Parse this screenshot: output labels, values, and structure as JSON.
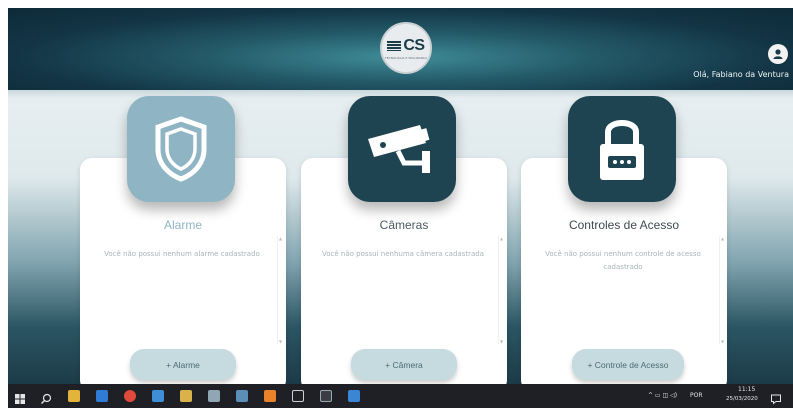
{
  "header": {
    "logo_text": "CS",
    "logo_subtext": "TECNOLOGIA E SEGURANÇA",
    "user_greeting": "Olá, Fabiano da Ventura",
    "colors": {
      "bar_dark": "#0e2a38",
      "bar_light": "#3f8c98"
    }
  },
  "cards": [
    {
      "title": "Alarme",
      "empty_message": "Você não possui nenhum alarme cadastrado",
      "button_label": "+ Alarme",
      "icon": "shield-icon",
      "icon_bg": "#8fb5c4",
      "title_color": "#8fb5c4"
    },
    {
      "title": "Câmeras",
      "empty_message": "Você não possui nenhuma câmera cadastrada",
      "button_label": "+ Câmera",
      "icon": "security-camera-icon",
      "icon_bg": "#1e4452",
      "title_color": "#4b5a5f"
    },
    {
      "title": "Controles de Acesso",
      "empty_message": "Você não possui nenhum controle de acesso cadastrado",
      "button_label": "+ Controle de Acesso",
      "icon": "padlock-icon",
      "icon_bg": "#1e4452",
      "title_color": "#3d4a4f"
    }
  ],
  "taskbar": {
    "language": "POR",
    "time": "11:15",
    "date": "25/03/2020",
    "apps": [
      "start-icon",
      "search-icon",
      "file-explorer-icon",
      "browser-icon",
      "chrome-icon",
      "network-app-icon",
      "app-icon",
      "user-app-icon",
      "window-app-icon",
      "vlc-icon",
      "tablet-icon",
      "terminal-icon",
      "store-icon"
    ]
  }
}
